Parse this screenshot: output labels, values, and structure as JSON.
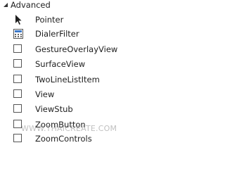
{
  "section": {
    "title": "Advanced",
    "expanded": true
  },
  "items": [
    {
      "label": "Pointer",
      "icon": "pointer-arrow-icon"
    },
    {
      "label": "DialerFilter",
      "icon": "dialer-filter-icon"
    },
    {
      "label": "GestureOverlayView",
      "icon": "widget-square-icon"
    },
    {
      "label": "SurfaceView",
      "icon": "widget-square-icon"
    },
    {
      "label": "TwoLineListItem",
      "icon": "widget-square-icon"
    },
    {
      "label": "View",
      "icon": "widget-square-icon"
    },
    {
      "label": "ViewStub",
      "icon": "widget-square-icon"
    },
    {
      "label": "ZoomButton",
      "icon": "widget-square-icon"
    },
    {
      "label": "ZoomControls",
      "icon": "widget-square-icon"
    }
  ],
  "watermark": "WWW.THAICREATE.COM",
  "colors": {
    "text": "#1e1e1e",
    "icon_border": "#555555",
    "dialer_blue": "#3c78c8"
  }
}
